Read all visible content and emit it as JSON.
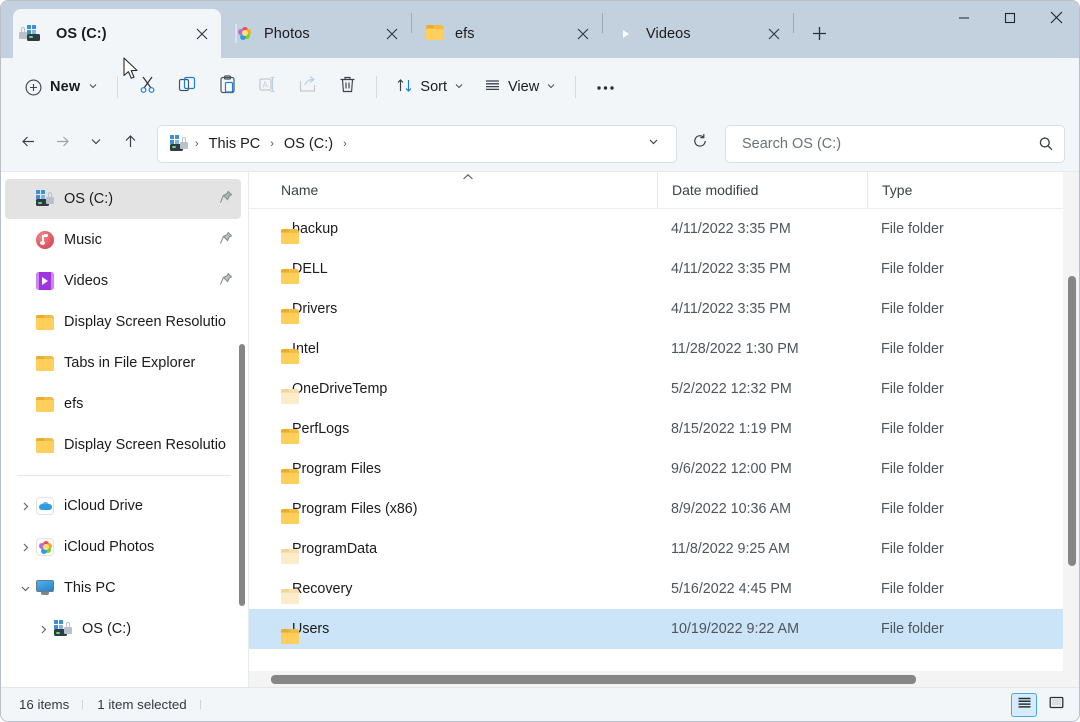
{
  "window": {
    "controls": {
      "minimize": "minimize-button",
      "maximize": "maximize-button",
      "close": "close-button"
    }
  },
  "tabs": {
    "items": [
      {
        "label": "OS (C:)",
        "icon": "drive-bitlocker-icon",
        "active": true
      },
      {
        "label": "Photos",
        "icon": "photos-icon",
        "active": false
      },
      {
        "label": "efs",
        "icon": "folder-icon",
        "active": false
      },
      {
        "label": "Videos",
        "icon": "video-icon",
        "active": false
      }
    ],
    "new_tab_label": "+"
  },
  "toolbar": {
    "new_label": "New",
    "sort_label": "Sort",
    "view_label": "View",
    "buttons": [
      {
        "name": "cut-button",
        "icon": "scissors-icon",
        "enabled": true
      },
      {
        "name": "copy-button",
        "icon": "copy-icon",
        "enabled": true
      },
      {
        "name": "paste-button",
        "icon": "clipboard-icon",
        "enabled": true
      },
      {
        "name": "rename-button",
        "icon": "rename-icon",
        "enabled": false
      },
      {
        "name": "share-button",
        "icon": "share-icon",
        "enabled": false
      },
      {
        "name": "delete-button",
        "icon": "trash-icon",
        "enabled": true
      }
    ],
    "overflow_label": "•••"
  },
  "address": {
    "back": "back-arrow-icon",
    "forward": "forward-arrow-icon",
    "recent": "chevron-down-icon",
    "up": "up-arrow-icon",
    "crumb_icon": "drive-bitlocker-icon",
    "crumbs": [
      "This PC",
      "OS (C:)"
    ],
    "separator": "›",
    "dropdown": "chevron-down-icon",
    "refresh": "refresh-icon"
  },
  "search": {
    "placeholder": "Search OS (C:)",
    "value": "",
    "icon": "search-icon"
  },
  "sidebar": {
    "quick_items": [
      {
        "label": "OS (C:)",
        "icon": "drive-bitlocker-icon",
        "pinned": true,
        "selected": true
      },
      {
        "label": "Music",
        "icon": "music-icon",
        "pinned": true,
        "selected": false
      },
      {
        "label": "Videos",
        "icon": "video-icon",
        "pinned": true,
        "selected": false
      },
      {
        "label": "Display Screen Resolutio",
        "icon": "folder-icon",
        "pinned": false,
        "selected": false
      },
      {
        "label": "Tabs in File Explorer",
        "icon": "folder-icon",
        "pinned": false,
        "selected": false
      },
      {
        "label": "efs",
        "icon": "folder-icon",
        "pinned": false,
        "selected": false
      },
      {
        "label": "Display Screen Resolutio",
        "icon": "folder-icon",
        "pinned": false,
        "selected": false
      }
    ],
    "tree_items": [
      {
        "label": "iCloud Drive",
        "icon": "cloud-icon",
        "expanded": false,
        "indent": 0
      },
      {
        "label": "iCloud Photos",
        "icon": "photos-icon",
        "expanded": false,
        "indent": 0
      },
      {
        "label": "This PC",
        "icon": "pc-icon",
        "expanded": true,
        "indent": 0
      },
      {
        "label": "OS (C:)",
        "icon": "drive-bitlocker-icon",
        "expanded": false,
        "indent": 1
      }
    ]
  },
  "filelist": {
    "columns": [
      "Name",
      "Date modified",
      "Type"
    ],
    "sort_column": "Name",
    "sort_direction": "ascending",
    "rows": [
      {
        "name": "backup",
        "date": "4/11/2022 3:35 PM",
        "type": "File folder",
        "icon": "folder-icon",
        "selected": false
      },
      {
        "name": "DELL",
        "date": "4/11/2022 3:35 PM",
        "type": "File folder",
        "icon": "folder-icon",
        "selected": false
      },
      {
        "name": "Drivers",
        "date": "4/11/2022 3:35 PM",
        "type": "File folder",
        "icon": "folder-icon",
        "selected": false
      },
      {
        "name": "Intel",
        "date": "11/28/2022 1:30 PM",
        "type": "File folder",
        "icon": "folder-icon",
        "selected": false
      },
      {
        "name": "OneDriveTemp",
        "date": "5/2/2022 12:32 PM",
        "type": "File folder",
        "icon": "folder-dim-icon",
        "selected": false
      },
      {
        "name": "PerfLogs",
        "date": "8/15/2022 1:19 PM",
        "type": "File folder",
        "icon": "folder-icon",
        "selected": false
      },
      {
        "name": "Program Files",
        "date": "9/6/2022 12:00 PM",
        "type": "File folder",
        "icon": "folder-icon",
        "selected": false
      },
      {
        "name": "Program Files (x86)",
        "date": "8/9/2022 10:36 AM",
        "type": "File folder",
        "icon": "folder-icon",
        "selected": false
      },
      {
        "name": "ProgramData",
        "date": "11/8/2022 9:25 AM",
        "type": "File folder",
        "icon": "folder-dim-icon",
        "selected": false
      },
      {
        "name": "Recovery",
        "date": "5/16/2022 4:45 PM",
        "type": "File folder",
        "icon": "folder-dim-icon",
        "selected": false
      },
      {
        "name": "Users",
        "date": "10/19/2022 9:22 AM",
        "type": "File folder",
        "icon": "folder-icon",
        "selected": true
      }
    ]
  },
  "status": {
    "item_count": "16 items",
    "selection": "1 item selected",
    "view_details": "details-view-button",
    "view_large": "large-icons-view-button"
  },
  "colors": {
    "titlebar": "#c3d0de",
    "toolbar": "#f3f6f9",
    "accent": "#0f6cbd",
    "selection": "#cce4f7",
    "folder": "#ffcf5c",
    "scrollbar": "#868686"
  }
}
